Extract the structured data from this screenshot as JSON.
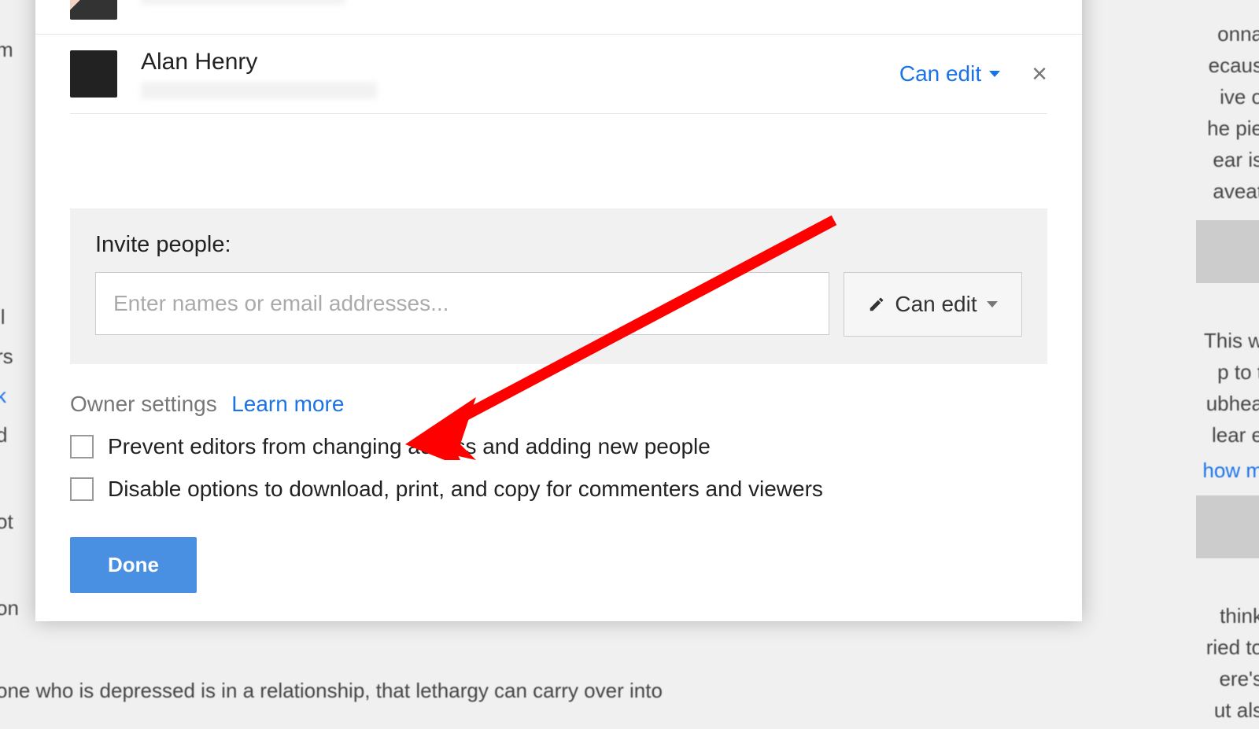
{
  "people": [
    {
      "name": "",
      "permission": ""
    },
    {
      "name": "Alan Henry",
      "permission": "Can edit"
    }
  ],
  "invite": {
    "label": "Invite people:",
    "placeholder": "Enter names or email addresses...",
    "default_permission": "Can edit"
  },
  "owner_settings": {
    "heading": "Owner settings",
    "learn_more": "Learn more",
    "options": [
      "Prevent editors from changing access and adding new people",
      "Disable options to download, print, and copy for commenters and viewers"
    ]
  },
  "done_label": "Done",
  "bg_fragments": {
    "left": [
      "m",
      "il",
      "rs",
      "k",
      "d",
      "ot",
      "on",
      "one who is depressed is in a relationship, that lethargy can carry over into"
    ],
    "right": [
      "onna",
      "ecaus",
      "ive o",
      "he pie",
      "ear is",
      "aveat",
      "This w",
      "p to t",
      "ubhea",
      "lear e",
      "how m",
      "think",
      "ried to",
      "ere's",
      "ut als"
    ]
  }
}
